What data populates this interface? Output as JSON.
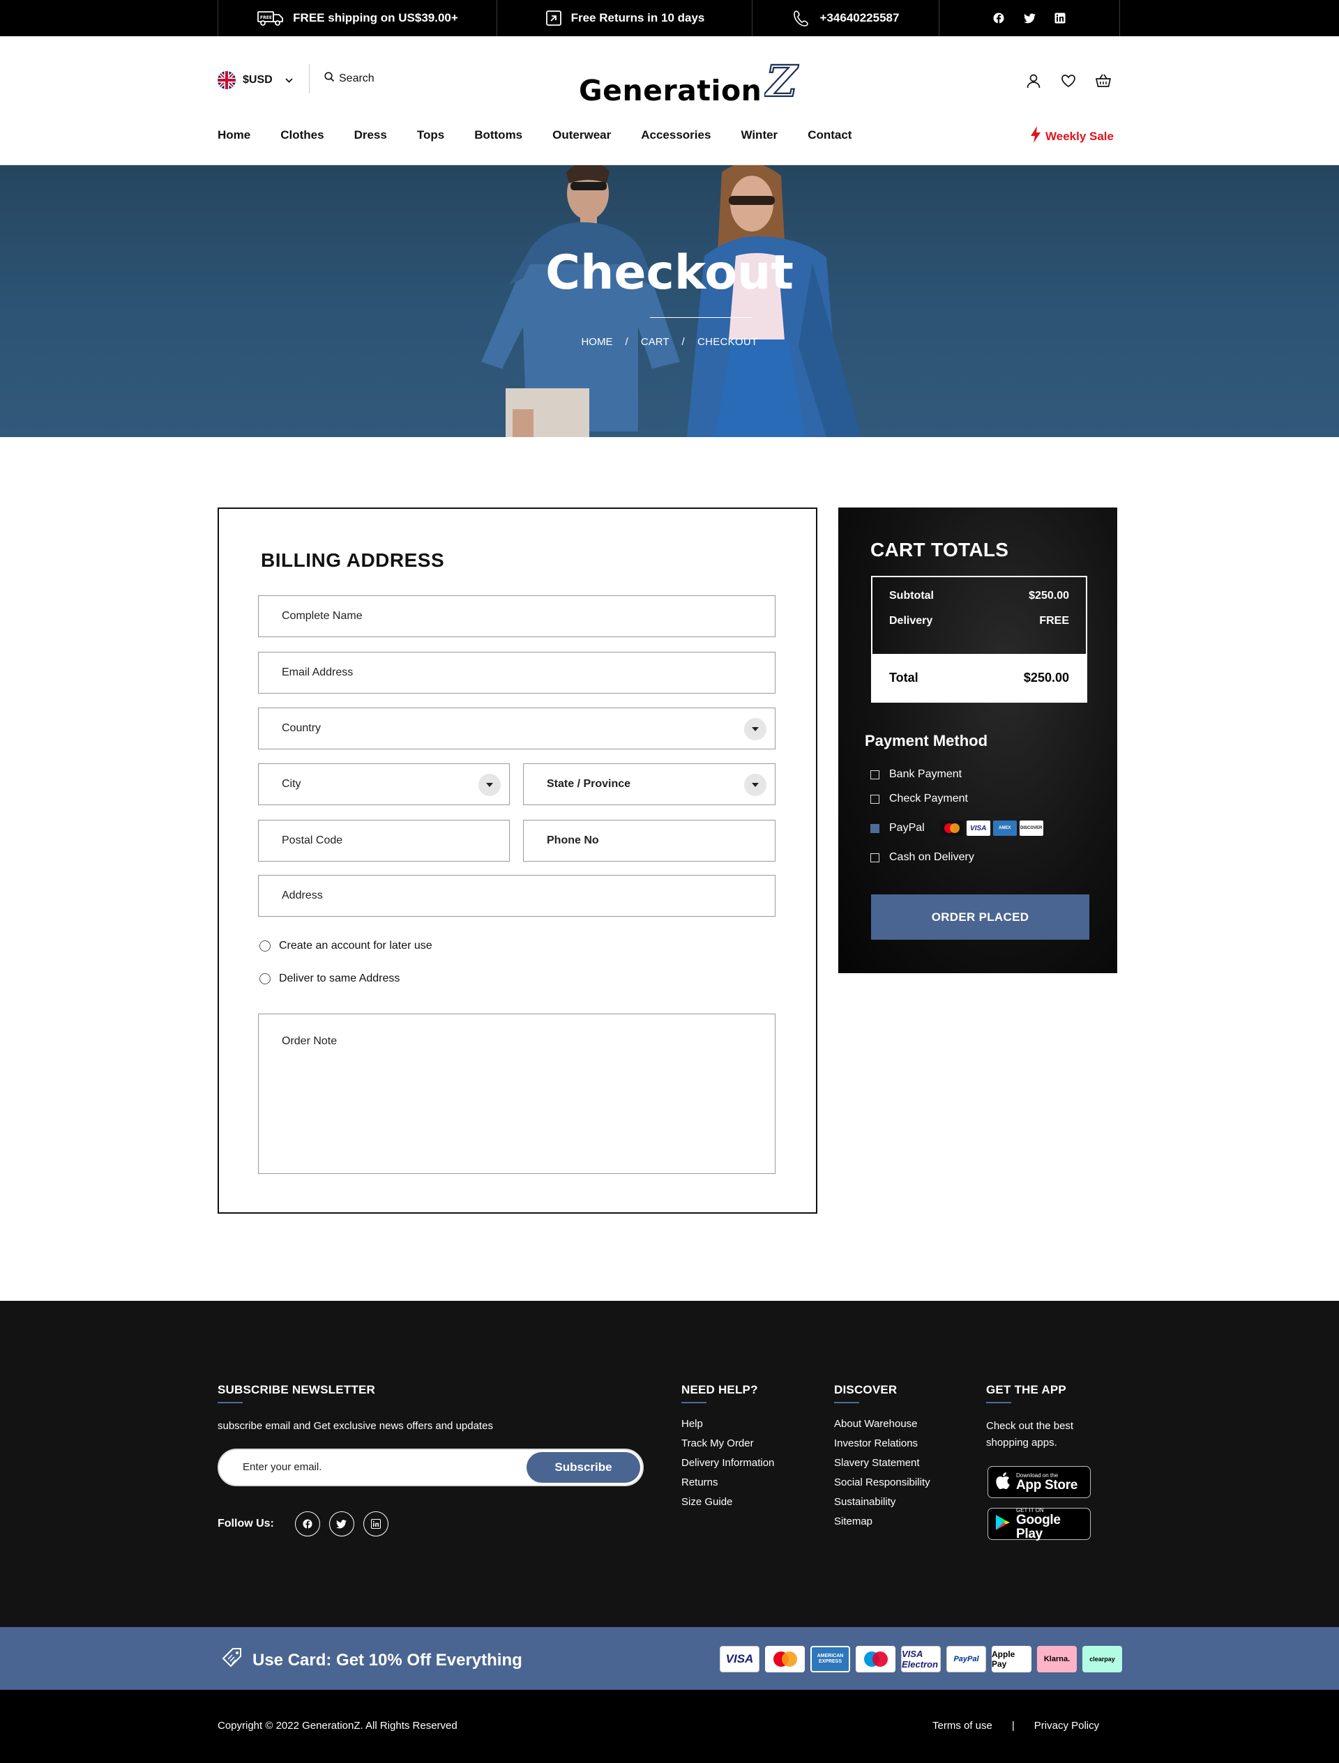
{
  "topbar": {
    "shipping_text": "FREE shipping on US$39.00+",
    "returns_text": "Free Returns in 10 days",
    "phone_text": "+34640225587",
    "social_icons": [
      "facebook-icon",
      "twitter-icon",
      "linkedin-icon"
    ]
  },
  "header": {
    "currency": "$USD",
    "search_label": "Search",
    "logo_text": "Generation",
    "logo_mark": "Z",
    "nav": [
      "Home",
      "Clothes",
      "Dress",
      "Tops",
      "Bottoms",
      "Outerwear",
      "Accessories",
      "Winter",
      "Contact"
    ],
    "weekly_sale": "Weekly Sale",
    "accent_red": "#e0141c"
  },
  "hero": {
    "title": "Checkout",
    "breadcrumb": [
      "HOME",
      "CART",
      "CHECKOUT"
    ],
    "breadcrumb_sep": "/"
  },
  "billing": {
    "title": "BILLING ADDRESS",
    "placeholders": {
      "name": "Complete Name",
      "email": "Email Address",
      "country": "Country",
      "city": "City",
      "state": "State / Province",
      "postal": "Postal Code",
      "phone": "Phone No",
      "address": "Address",
      "note": "Order Note"
    },
    "options": {
      "create_account": "Create an account for later use",
      "same_address": "Deliver to same Address"
    }
  },
  "cart": {
    "title": "CART TOTALS",
    "subtotal_label": "Subtotal",
    "subtotal_value": "$250.00",
    "delivery_label": "Delivery",
    "delivery_value": "FREE",
    "total_label": "Total",
    "total_value": "$250.00",
    "payment_title": "Payment Method",
    "payment_methods": [
      {
        "label": "Bank Payment",
        "checked": false
      },
      {
        "label": "Check Payment",
        "checked": false
      },
      {
        "label": "PayPal",
        "checked": true
      },
      {
        "label": "Cash on Delivery",
        "checked": false
      }
    ],
    "paypal_cards": [
      "mastercard",
      "VISA",
      "AMEX",
      "DISCOVER"
    ],
    "order_button": "ORDER PLACED",
    "button_color": "#4a6591"
  },
  "footer": {
    "newsletter_title": "SUBSCRIBE NEWSLETTER",
    "newsletter_text": "subscribe email and Get exclusive news offers and updates",
    "email_placeholder": "Enter your email.",
    "subscribe_label": "Subscribe",
    "follow_label": "Follow Us:",
    "help_title": "NEED HELP?",
    "help_links": [
      "Help",
      "Track My Order",
      "Delivery Information",
      "Returns",
      "Size Guide"
    ],
    "discover_title": "DISCOVER",
    "discover_links": [
      "About Warehouse",
      "Investor Relations",
      "Slavery Statement",
      "Social Responsibility",
      "Sustainability",
      "Sitemap"
    ],
    "app_title": "GET THE APP",
    "app_text": "Check out the best shopping apps.",
    "appstore_small": "Download on the",
    "appstore_big": "App Store",
    "googleplay_small": "GET IT ON",
    "googleplay_big": "Google Play"
  },
  "promo": {
    "text": "Use Card:  Get 10% Off Everything",
    "payment_logos": [
      "VISA",
      "mastercard",
      "AMERICAN EXPRESS",
      "maestro",
      "VISA Electron",
      "PayPal",
      "Apple Pay",
      "Klarna.",
      "clearpay"
    ]
  },
  "copyright": {
    "text": "Copyright © 2022 GenerationZ. All Rights Reserved",
    "terms": "Terms of use",
    "separator": "|",
    "privacy": "Privacy Policy"
  }
}
